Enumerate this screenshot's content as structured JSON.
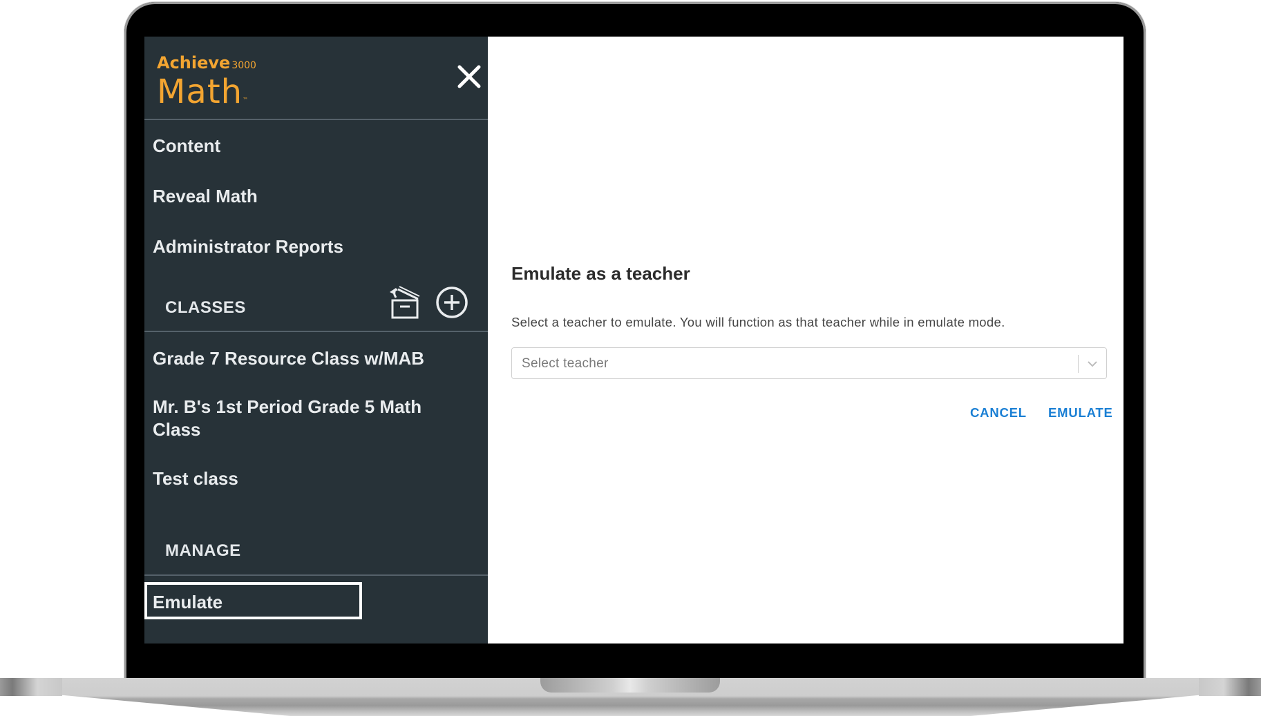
{
  "brand": {
    "line1": "Achieve",
    "line1_suffix": "3000",
    "line2": "Math",
    "trademark": "™",
    "color": "#f3a531"
  },
  "sidebar": {
    "nav_items": [
      {
        "label": "Content"
      },
      {
        "label": "Reveal Math"
      },
      {
        "label": "Administrator Reports"
      }
    ],
    "classes_header": "CLASSES",
    "classes": [
      {
        "label": "Grade 7 Resource Class w/MAB"
      },
      {
        "label": "Mr. B's 1st Period Grade 5 Math Class"
      },
      {
        "label": "Test class"
      }
    ],
    "manage_header": "MANAGE",
    "manage_items": [
      {
        "label": "Emulate",
        "selected": true
      }
    ],
    "icons": {
      "close": "close-icon",
      "archive": "archive-icon",
      "add": "add-circle-icon"
    }
  },
  "dialog": {
    "title": "Emulate as a teacher",
    "description": "Select a teacher to emulate. You will function as that teacher while in emulate mode.",
    "select": {
      "placeholder": "Select teacher",
      "value": ""
    },
    "cancel_label": "CANCEL",
    "confirm_label": "EMULATE",
    "accent_color": "#1a7fd4"
  }
}
